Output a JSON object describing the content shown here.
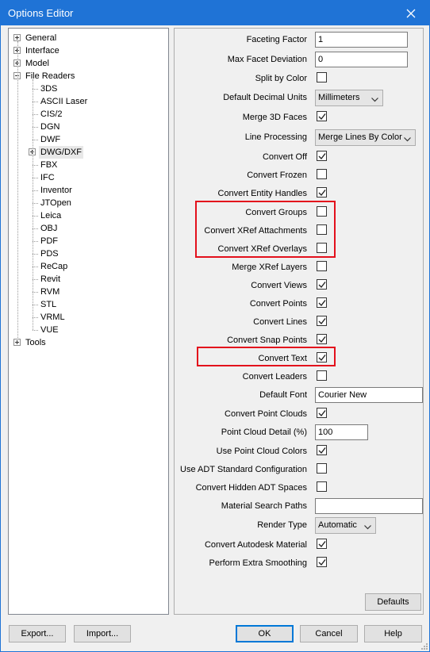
{
  "window": {
    "title": "Options Editor",
    "close_glyph": "✕"
  },
  "tree": {
    "items": [
      {
        "label": "General",
        "name": "tree-item-general",
        "icon": "expand-plus-icon"
      },
      {
        "label": "Interface",
        "name": "tree-item-interface",
        "icon": "expand-plus-icon"
      },
      {
        "label": "Model",
        "name": "tree-item-model",
        "icon": "expand-plus-icon"
      },
      {
        "label": "File Readers",
        "name": "tree-item-file-readers",
        "icon": "collapse-minus-icon"
      },
      {
        "label": "3DS",
        "name": "tree-item-3ds"
      },
      {
        "label": "ASCII Laser",
        "name": "tree-item-ascii-laser"
      },
      {
        "label": "CIS/2",
        "name": "tree-item-cis2"
      },
      {
        "label": "DGN",
        "name": "tree-item-dgn"
      },
      {
        "label": "DWF",
        "name": "tree-item-dwf"
      },
      {
        "label": "DWG/DXF",
        "name": "tree-item-dwg-dxf",
        "icon": "expand-plus-icon",
        "selected": true
      },
      {
        "label": "FBX",
        "name": "tree-item-fbx"
      },
      {
        "label": "IFC",
        "name": "tree-item-ifc"
      },
      {
        "label": "Inventor",
        "name": "tree-item-inventor"
      },
      {
        "label": "JTOpen",
        "name": "tree-item-jtopen"
      },
      {
        "label": "Leica",
        "name": "tree-item-leica"
      },
      {
        "label": "OBJ",
        "name": "tree-item-obj"
      },
      {
        "label": "PDF",
        "name": "tree-item-pdf"
      },
      {
        "label": "PDS",
        "name": "tree-item-pds"
      },
      {
        "label": "ReCap",
        "name": "tree-item-recap"
      },
      {
        "label": "Revit",
        "name": "tree-item-revit"
      },
      {
        "label": "RVM",
        "name": "tree-item-rvm"
      },
      {
        "label": "STL",
        "name": "tree-item-stl"
      },
      {
        "label": "VRML",
        "name": "tree-item-vrml"
      },
      {
        "label": "VUE",
        "name": "tree-item-vue"
      },
      {
        "label": "Tools",
        "name": "tree-item-tools",
        "icon": "expand-plus-icon"
      }
    ]
  },
  "settings": [
    {
      "label": "Faceting Factor",
      "type": "text",
      "value": "1"
    },
    {
      "label": "Max Facet Deviation",
      "type": "text",
      "value": "0"
    },
    {
      "label": "Split by Color",
      "type": "check",
      "checked": false
    },
    {
      "label": "Default Decimal Units",
      "type": "select",
      "value": "Millimeters"
    },
    {
      "label": "Merge 3D Faces",
      "type": "check",
      "checked": true
    },
    {
      "label": "Line Processing",
      "type": "select",
      "value": "Merge Lines By Color"
    },
    {
      "label": "Convert Off",
      "type": "check",
      "checked": true
    },
    {
      "label": "Convert Frozen",
      "type": "check",
      "checked": false
    },
    {
      "label": "Convert Entity Handles",
      "type": "check",
      "checked": true
    },
    {
      "label": "Convert Groups",
      "type": "check",
      "checked": false
    },
    {
      "label": "Convert XRef Attachments",
      "type": "check",
      "checked": false
    },
    {
      "label": "Convert XRef Overlays",
      "type": "check",
      "checked": false
    },
    {
      "label": "Merge XRef Layers",
      "type": "check",
      "checked": false
    },
    {
      "label": "Convert Views",
      "type": "check",
      "checked": true
    },
    {
      "label": "Convert Points",
      "type": "check",
      "checked": true
    },
    {
      "label": "Convert Lines",
      "type": "check",
      "checked": true
    },
    {
      "label": "Convert Snap Points",
      "type": "check",
      "checked": true
    },
    {
      "label": "Convert Text",
      "type": "check",
      "checked": true
    },
    {
      "label": "Convert Leaders",
      "type": "check",
      "checked": false
    },
    {
      "label": "Default Font",
      "type": "text",
      "value": "Courier New"
    },
    {
      "label": "Convert Point Clouds",
      "type": "check",
      "checked": true
    },
    {
      "label": "Point Cloud Detail (%)",
      "type": "text",
      "value": "100"
    },
    {
      "label": "Use Point Cloud Colors",
      "type": "check",
      "checked": true
    },
    {
      "label": "Use ADT Standard Configuration",
      "type": "check",
      "checked": false
    },
    {
      "label": "Convert Hidden ADT Spaces",
      "type": "check",
      "checked": false
    },
    {
      "label": "Material Search Paths",
      "type": "text",
      "value": ""
    },
    {
      "label": "Render Type",
      "type": "select",
      "value": "Automatic"
    },
    {
      "label": "Convert Autodesk Material",
      "type": "check",
      "checked": true
    },
    {
      "label": "Perform Extra Smoothing",
      "type": "check",
      "checked": true
    }
  ],
  "buttons": {
    "defaults": "Defaults",
    "export": "Export...",
    "import": "Import...",
    "ok": "OK",
    "cancel": "Cancel",
    "help": "Help"
  },
  "colors": {
    "titlebar": "#1f73d6",
    "highlight": "#e3101c",
    "accent": "#0078d7"
  }
}
